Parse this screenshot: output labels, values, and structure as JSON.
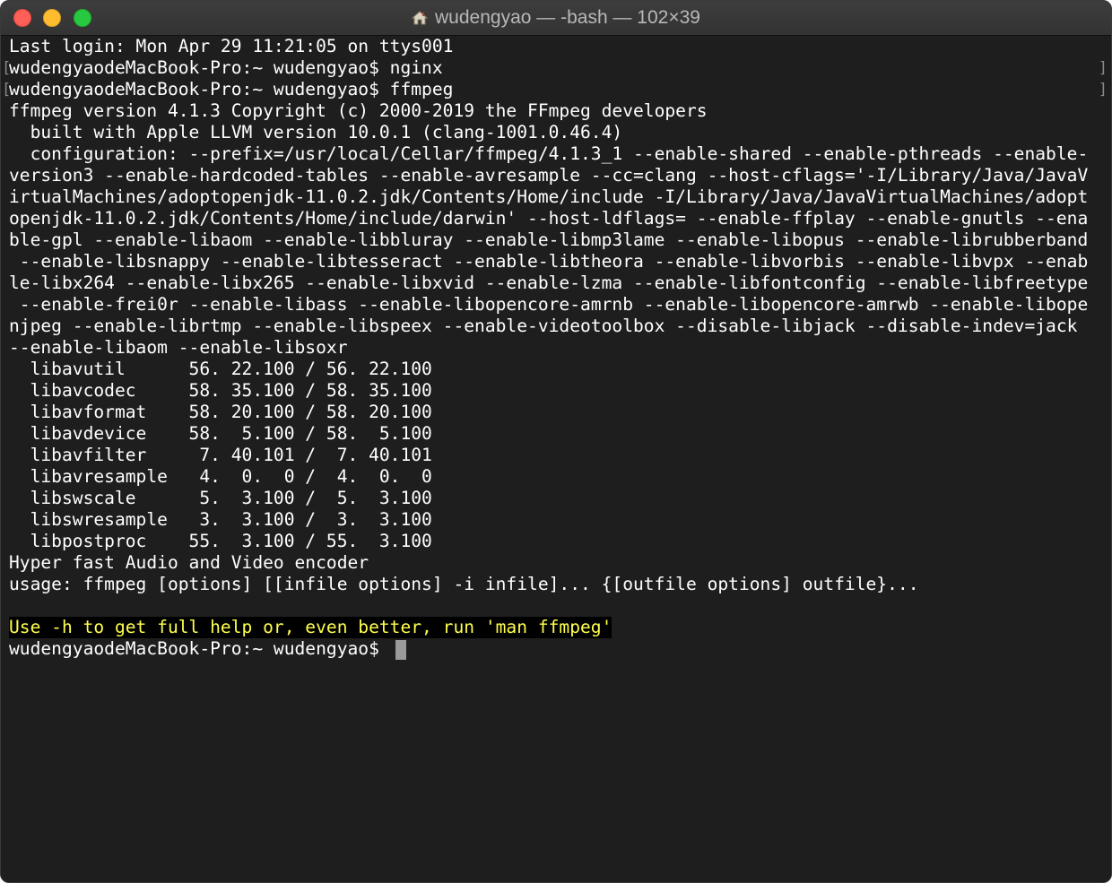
{
  "window": {
    "title": "wudengyao — -bash — 102×39",
    "title_icon": "home-icon"
  },
  "terminal": {
    "lines": [
      "Last login: Mon Apr 29 11:21:05 on ttys001",
      "wudengyaodeMacBook-Pro:~ wudengyao$ nginx",
      "wudengyaodeMacBook-Pro:~ wudengyao$ ffmpeg",
      "ffmpeg version 4.1.3 Copyright (c) 2000-2019 the FFmpeg developers",
      "  built with Apple LLVM version 10.0.1 (clang-1001.0.46.4)",
      "  configuration: --prefix=/usr/local/Cellar/ffmpeg/4.1.3_1 --enable-shared --enable-pthreads --enable-",
      "version3 --enable-hardcoded-tables --enable-avresample --cc=clang --host-cflags='-I/Library/Java/JavaV",
      "irtualMachines/adoptopenjdk-11.0.2.jdk/Contents/Home/include -I/Library/Java/JavaVirtualMachines/adopt",
      "openjdk-11.0.2.jdk/Contents/Home/include/darwin' --host-ldflags= --enable-ffplay --enable-gnutls --ena",
      "ble-gpl --enable-libaom --enable-libbluray --enable-libmp3lame --enable-libopus --enable-librubberband",
      " --enable-libsnappy --enable-libtesseract --enable-libtheora --enable-libvorbis --enable-libvpx --enab",
      "le-libx264 --enable-libx265 --enable-libxvid --enable-lzma --enable-libfontconfig --enable-libfreetype",
      " --enable-frei0r --enable-libass --enable-libopencore-amrnb --enable-libopencore-amrwb --enable-libope",
      "njpeg --enable-librtmp --enable-libspeex --enable-videotoolbox --disable-libjack --disable-indev=jack",
      "--enable-libaom --enable-libsoxr",
      "  libavutil      56. 22.100 / 56. 22.100",
      "  libavcodec     58. 35.100 / 58. 35.100",
      "  libavformat    58. 20.100 / 58. 20.100",
      "  libavdevice    58.  5.100 / 58.  5.100",
      "  libavfilter     7. 40.101 /  7. 40.101",
      "  libavresample   4.  0.  0 /  4.  0.  0",
      "  libswscale      5.  3.100 /  5.  3.100",
      "  libswresample   3.  3.100 /  3.  3.100",
      "  libpostproc    55.  3.100 / 55.  3.100",
      "Hyper fast Audio and Video encoder",
      "usage: ffmpeg [options] [[infile options] -i infile]... {[outfile options] outfile}...",
      "",
      "Use -h to get full help or, even better, run 'man ffmpeg'",
      "wudengyaodeMacBook-Pro:~ wudengyao$ "
    ],
    "mark_left": "[",
    "mark_right": "]",
    "colors": {
      "background": "#1e1e1e",
      "foreground": "#ffffff",
      "highlight_text": "#ffff4c",
      "highlight_background": "#000000",
      "cursor": "#9a9a9a"
    }
  }
}
